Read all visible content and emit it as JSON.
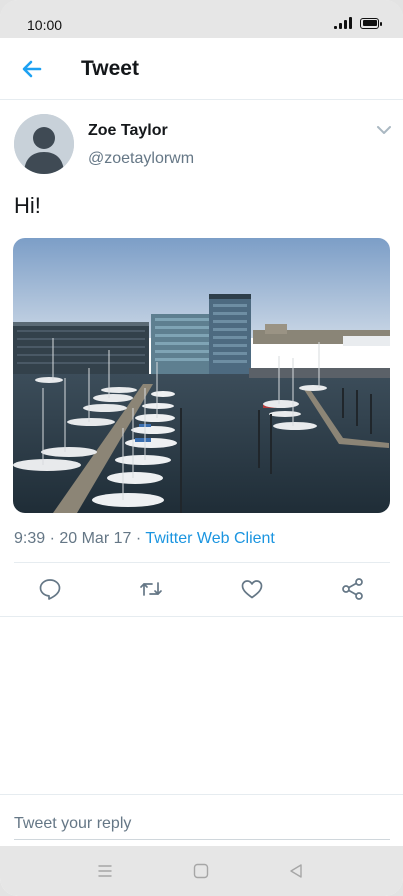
{
  "status_bar": {
    "time": "10:00",
    "icons": [
      "signal-icon",
      "battery-icon"
    ]
  },
  "header": {
    "back_icon": "arrow-left-icon",
    "title": "Tweet"
  },
  "tweet": {
    "author": {
      "name": "Zoe Taylor",
      "handle": "@zoetaylorwm",
      "avatar_icon": "default-avatar-icon"
    },
    "menu_icon": "chevron-down-icon",
    "text": "Hi!",
    "media": "photo of a marina with sailboats and modern office buildings",
    "meta": {
      "time": "9:39",
      "separator": " · ",
      "date": "20 Mar 17",
      "client": "Twitter Web Client"
    },
    "actions": [
      {
        "name": "reply",
        "icon": "reply-bubble-icon"
      },
      {
        "name": "retweet",
        "icon": "retweet-icon"
      },
      {
        "name": "like",
        "icon": "heart-icon"
      },
      {
        "name": "share",
        "icon": "share-icon"
      }
    ]
  },
  "reply_box": {
    "placeholder": "Tweet your reply",
    "value": ""
  },
  "nav_bar": {
    "buttons": [
      "menu-icon",
      "home-square-icon",
      "back-triangle-icon"
    ]
  },
  "colors": {
    "accent": "#1da1f2",
    "link": "#1b95e0",
    "secondary_text": "#657786",
    "primary_text": "#14171a"
  }
}
